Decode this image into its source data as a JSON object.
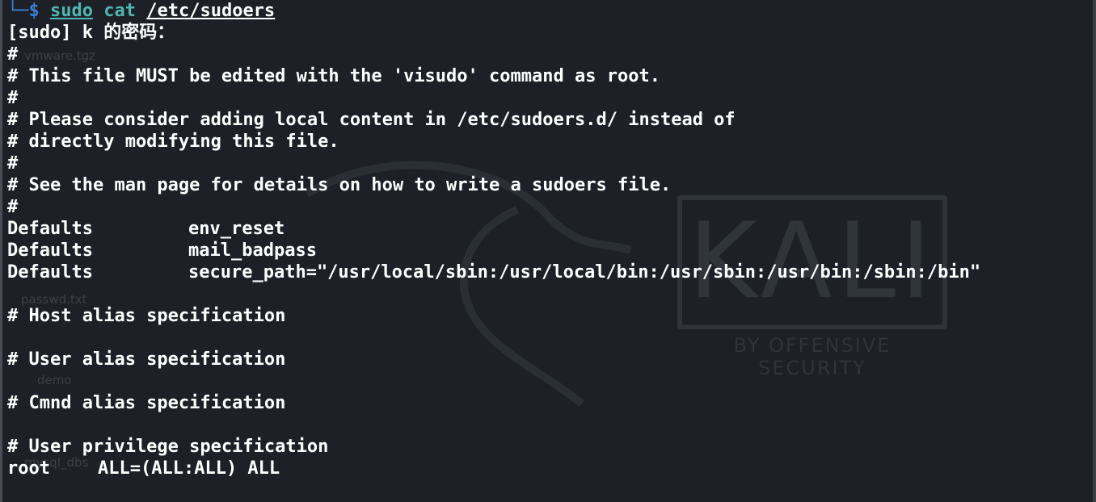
{
  "prompt": {
    "branch": "└─",
    "dollar": "$",
    "cmd_sudo": "sudo",
    "cmd_cat": "cat",
    "path": "/etc/sudoers"
  },
  "password_prompt": "[sudo] k 的密码：",
  "lines": {
    "c1": "#",
    "c2": "# This file MUST be edited with the 'visudo' command as root.",
    "c3": "#",
    "c4": "# Please consider adding local content in /etc/sudoers.d/ instead of",
    "c5": "# directly modifying this file.",
    "c6": "#",
    "c7": "# See the man page for details on how to write a sudoers file.",
    "c8": "#"
  },
  "defaults": [
    {
      "key": "Defaults",
      "value": "env_reset"
    },
    {
      "key": "Defaults",
      "value": "mail_badpass"
    },
    {
      "key": "Defaults",
      "value": "secure_path=\"/usr/local/sbin:/usr/local/bin:/usr/sbin:/usr/bin:/sbin:/bin\""
    }
  ],
  "sections": {
    "host_alias": "# Host alias specification",
    "user_alias": "# User alias specification",
    "cmnd_alias": "# Cmnd alias specification",
    "user_priv": "# User privilege specification"
  },
  "root_rule": {
    "user": "root",
    "rule": "ALL=(ALL:ALL) ALL"
  },
  "wallpaper": {
    "kali": "KALI",
    "kali_sub": "BY OFFENSIVE SECURITY",
    "desk_items": [
      "vmware.tgz",
      "passwd.txt",
      "demo",
      "mysql_dbs"
    ]
  },
  "colors": {
    "background": "#1d2026",
    "text": "#ffffff",
    "prompt": "#3b7fd9",
    "command": "#4fb7b2"
  }
}
